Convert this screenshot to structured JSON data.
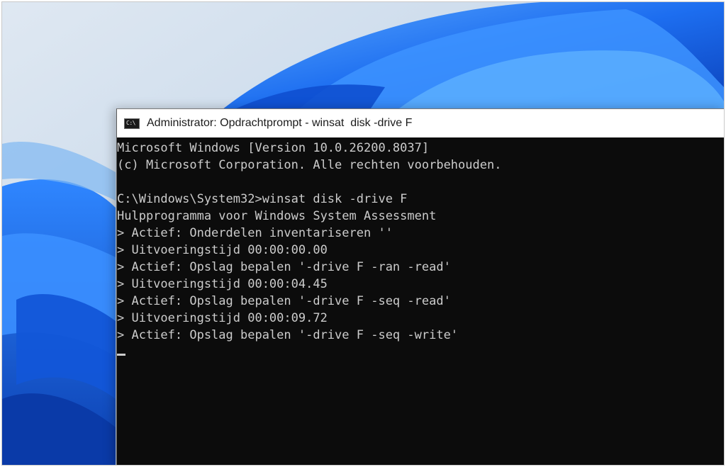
{
  "window": {
    "title": "Administrator: Opdrachtprompt - winsat  disk -drive F",
    "icon_name": "cmd-icon",
    "icon_text": "C:\\"
  },
  "console": {
    "lines": [
      "Microsoft Windows [Version 10.0.26200.8037]",
      "(c) Microsoft Corporation. Alle rechten voorbehouden.",
      "",
      "C:\\Windows\\System32>winsat disk -drive F",
      "Hulpprogramma voor Windows System Assessment",
      "> Actief: Onderdelen inventariseren ''",
      "> Uitvoeringstijd 00:00:00.00",
      "> Actief: Opslag bepalen '-drive F -ran -read'",
      "> Uitvoeringstijd 00:00:04.45",
      "> Actief: Opslag bepalen '-drive F -seq -read'",
      "> Uitvoeringstijd 00:00:09.72",
      "> Actief: Opslag bepalen '-drive F -seq -write'",
      ""
    ]
  },
  "colors": {
    "console_bg": "#0c0c0c",
    "console_text": "#cccccc",
    "titlebar_bg": "#ffffff",
    "wallpaper_accent": "#1a6fe0"
  }
}
